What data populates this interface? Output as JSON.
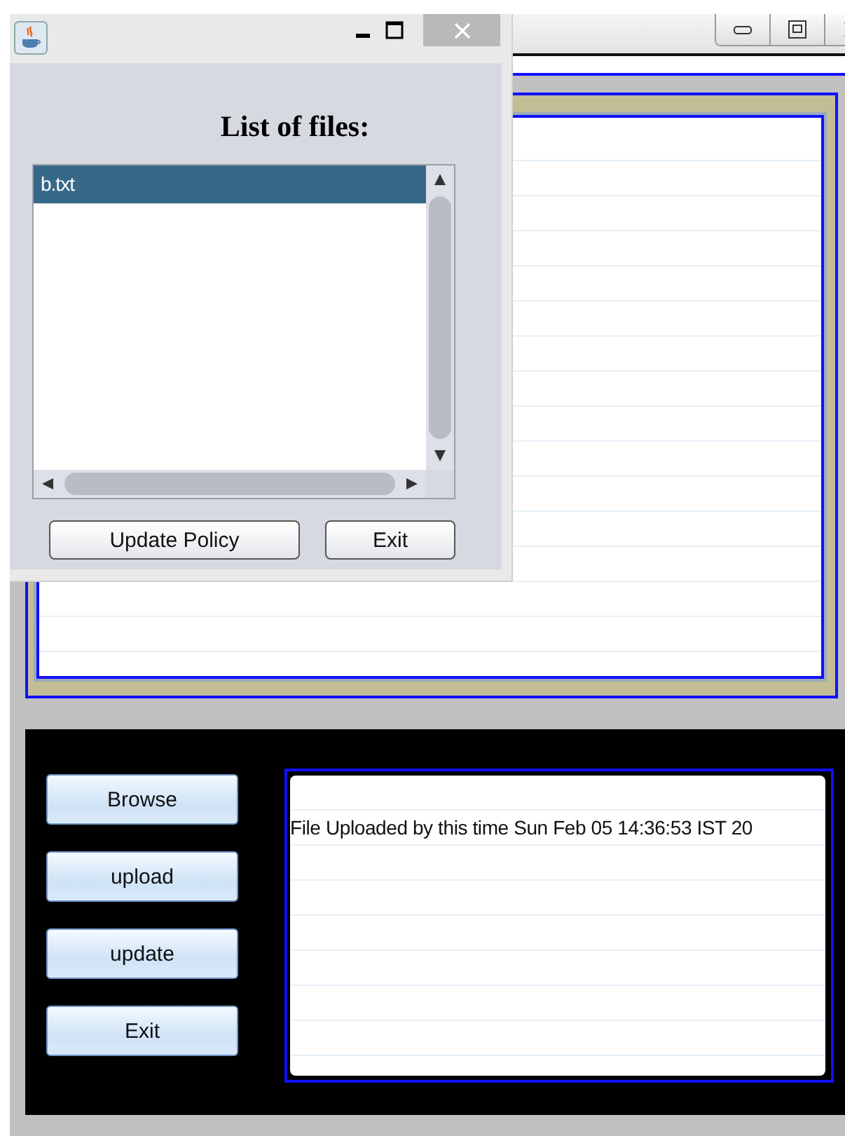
{
  "dialog": {
    "heading": "List of files:",
    "files": [
      {
        "name": "b.txt",
        "selected": true
      }
    ],
    "buttons": [
      "Update Policy",
      "Exit"
    ]
  },
  "control_panel": {
    "buttons": [
      "Browse",
      "upload",
      "update",
      "Exit"
    ],
    "log_lines": [
      "File Uploaded by this time Sun Feb 05 14:36:53 IST 20"
    ]
  }
}
